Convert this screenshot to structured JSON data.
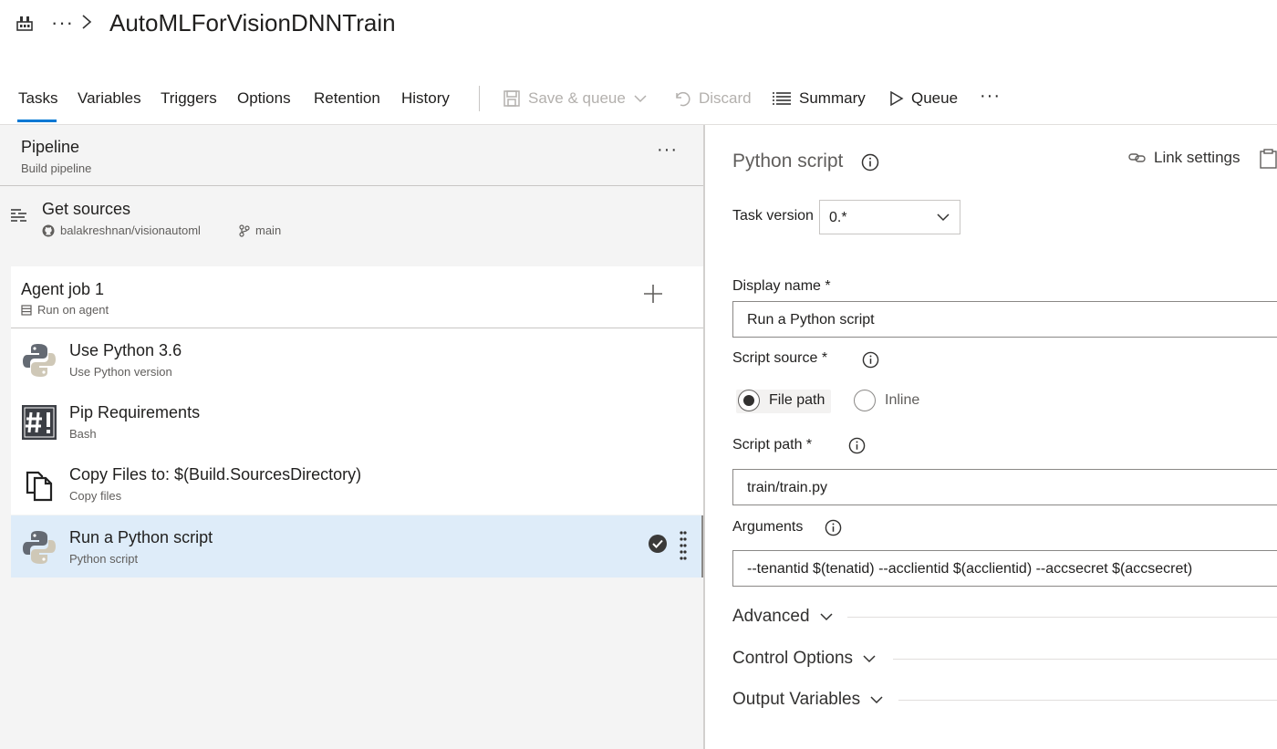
{
  "header": {
    "breadcrumb_ellipsis": "···",
    "title": "AutoMLForVisionDNNTrain"
  },
  "tabs": [
    {
      "label": "Tasks",
      "active": true
    },
    {
      "label": "Variables"
    },
    {
      "label": "Triggers"
    },
    {
      "label": "Options"
    },
    {
      "label": "Retention"
    },
    {
      "label": "History"
    }
  ],
  "toolbar": {
    "save_queue": "Save & queue",
    "discard": "Discard",
    "summary": "Summary",
    "queue": "Queue",
    "more": "···"
  },
  "pipeline": {
    "title": "Pipeline",
    "subtitle": "Build pipeline",
    "more": "···"
  },
  "sources": {
    "title": "Get sources",
    "repo": "balakreshnan/visionautoml",
    "branch": "main"
  },
  "job": {
    "title": "Agent job 1",
    "subtitle": "Run on agent"
  },
  "tasks": [
    {
      "title": "Use Python 3.6",
      "subtitle": "Use Python version",
      "icon": "python-icon"
    },
    {
      "title": "Pip Requirements",
      "subtitle": "Bash",
      "icon": "bash-icon"
    },
    {
      "title": "Copy Files to: $(Build.SourcesDirectory)",
      "subtitle": "Copy files",
      "icon": "copy-files-icon"
    },
    {
      "title": "Run a Python script",
      "subtitle": "Python script",
      "icon": "python-icon",
      "selected": true
    }
  ],
  "details": {
    "title": "Python script",
    "link_settings": "Link settings",
    "task_version_label": "Task version",
    "task_version_value": "0.*",
    "display_name_label": "Display name *",
    "display_name_value": "Run a Python script",
    "script_source_label": "Script source *",
    "script_source_options": [
      "File path",
      "Inline"
    ],
    "script_source_selected": "File path",
    "script_path_label": "Script path *",
    "script_path_value": "train/train.py",
    "arguments_label": "Arguments",
    "arguments_value": "--tenantid $(tenatid) --acclientid $(acclientid) --accsecret $(accsecret)",
    "sections": [
      "Advanced",
      "Control Options",
      "Output Variables"
    ]
  },
  "colors": {
    "accent": "#0078d4",
    "selected_row": "#deecf9",
    "pane_bg": "#f4f4f4"
  }
}
